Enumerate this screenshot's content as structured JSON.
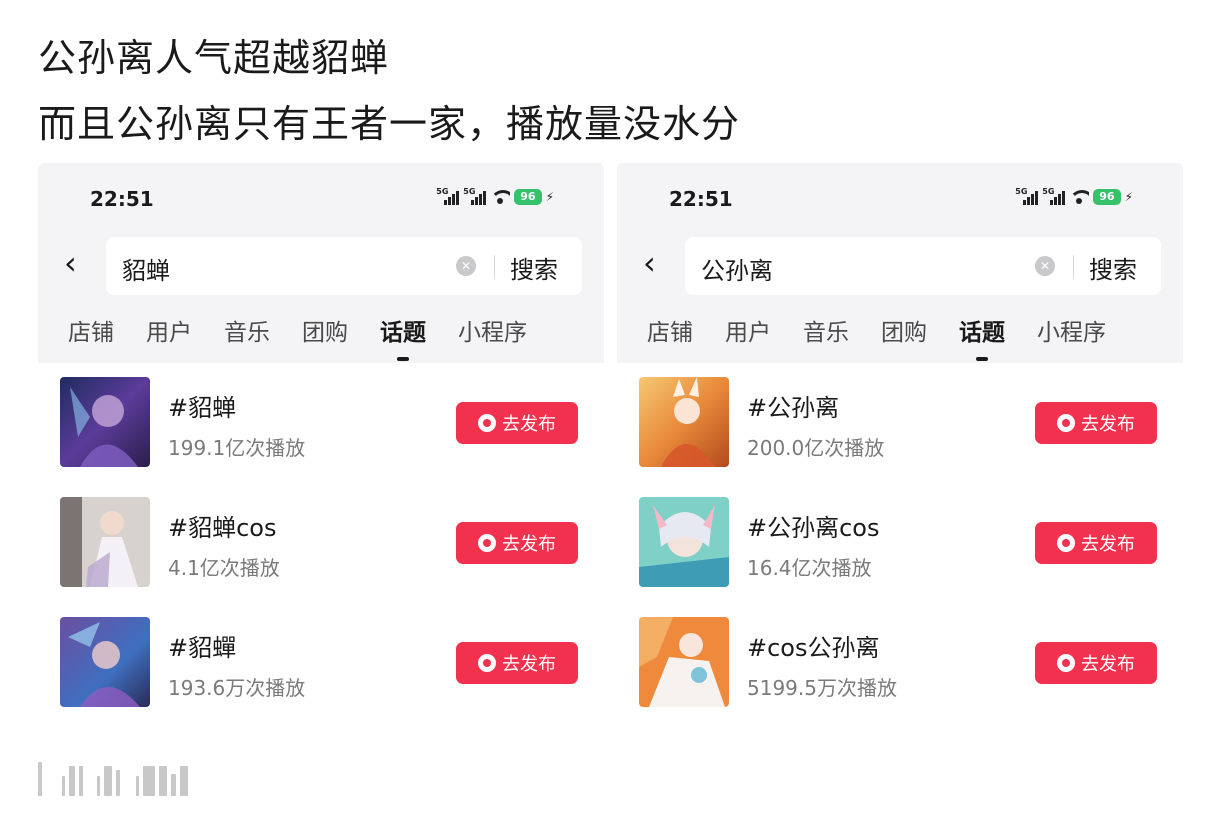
{
  "caption": {
    "line1": "公孙离人气超越貂蝉",
    "line2": "而且公孙离只有王者一家，播放量没水分"
  },
  "panels": [
    {
      "status": {
        "time": "22:51",
        "battery": "96",
        "signal_tag": "5G"
      },
      "search": {
        "query": "貂蝉",
        "button": "搜索"
      },
      "tabs": [
        "店铺",
        "用户",
        "音乐",
        "团购",
        "话题",
        "小程序"
      ],
      "active_tab": "话题",
      "topics": [
        {
          "name": "#貂蝉",
          "plays": "199.1亿次播放",
          "action": "去发布"
        },
        {
          "name": "#貂蝉cos",
          "plays": "4.1亿次播放",
          "action": "去发布"
        },
        {
          "name": "#貂蟬",
          "plays": "193.6万次播放",
          "action": "去发布"
        }
      ]
    },
    {
      "status": {
        "time": "22:51",
        "battery": "96",
        "signal_tag": "5G"
      },
      "search": {
        "query": "公孙离",
        "button": "搜索"
      },
      "tabs": [
        "店铺",
        "用户",
        "音乐",
        "团购",
        "话题",
        "小程序"
      ],
      "active_tab": "话题",
      "topics": [
        {
          "name": "#公孙离",
          "plays": "200.0亿次播放",
          "action": "去发布"
        },
        {
          "name": "#公孙离cos",
          "plays": "16.4亿次播放",
          "action": "去发布"
        },
        {
          "name": "#cos公孙离",
          "plays": "5199.5万次播放",
          "action": "去发布"
        }
      ]
    }
  ],
  "icons": {
    "back": "chevron-left-icon",
    "clear": "clear-icon",
    "publish": "camera-icon",
    "wifi": "wifi-icon",
    "battery": "battery-icon"
  },
  "colors": {
    "accent": "#f2314f",
    "battery": "#36c26a",
    "header_bg": "#f4f4f6"
  }
}
